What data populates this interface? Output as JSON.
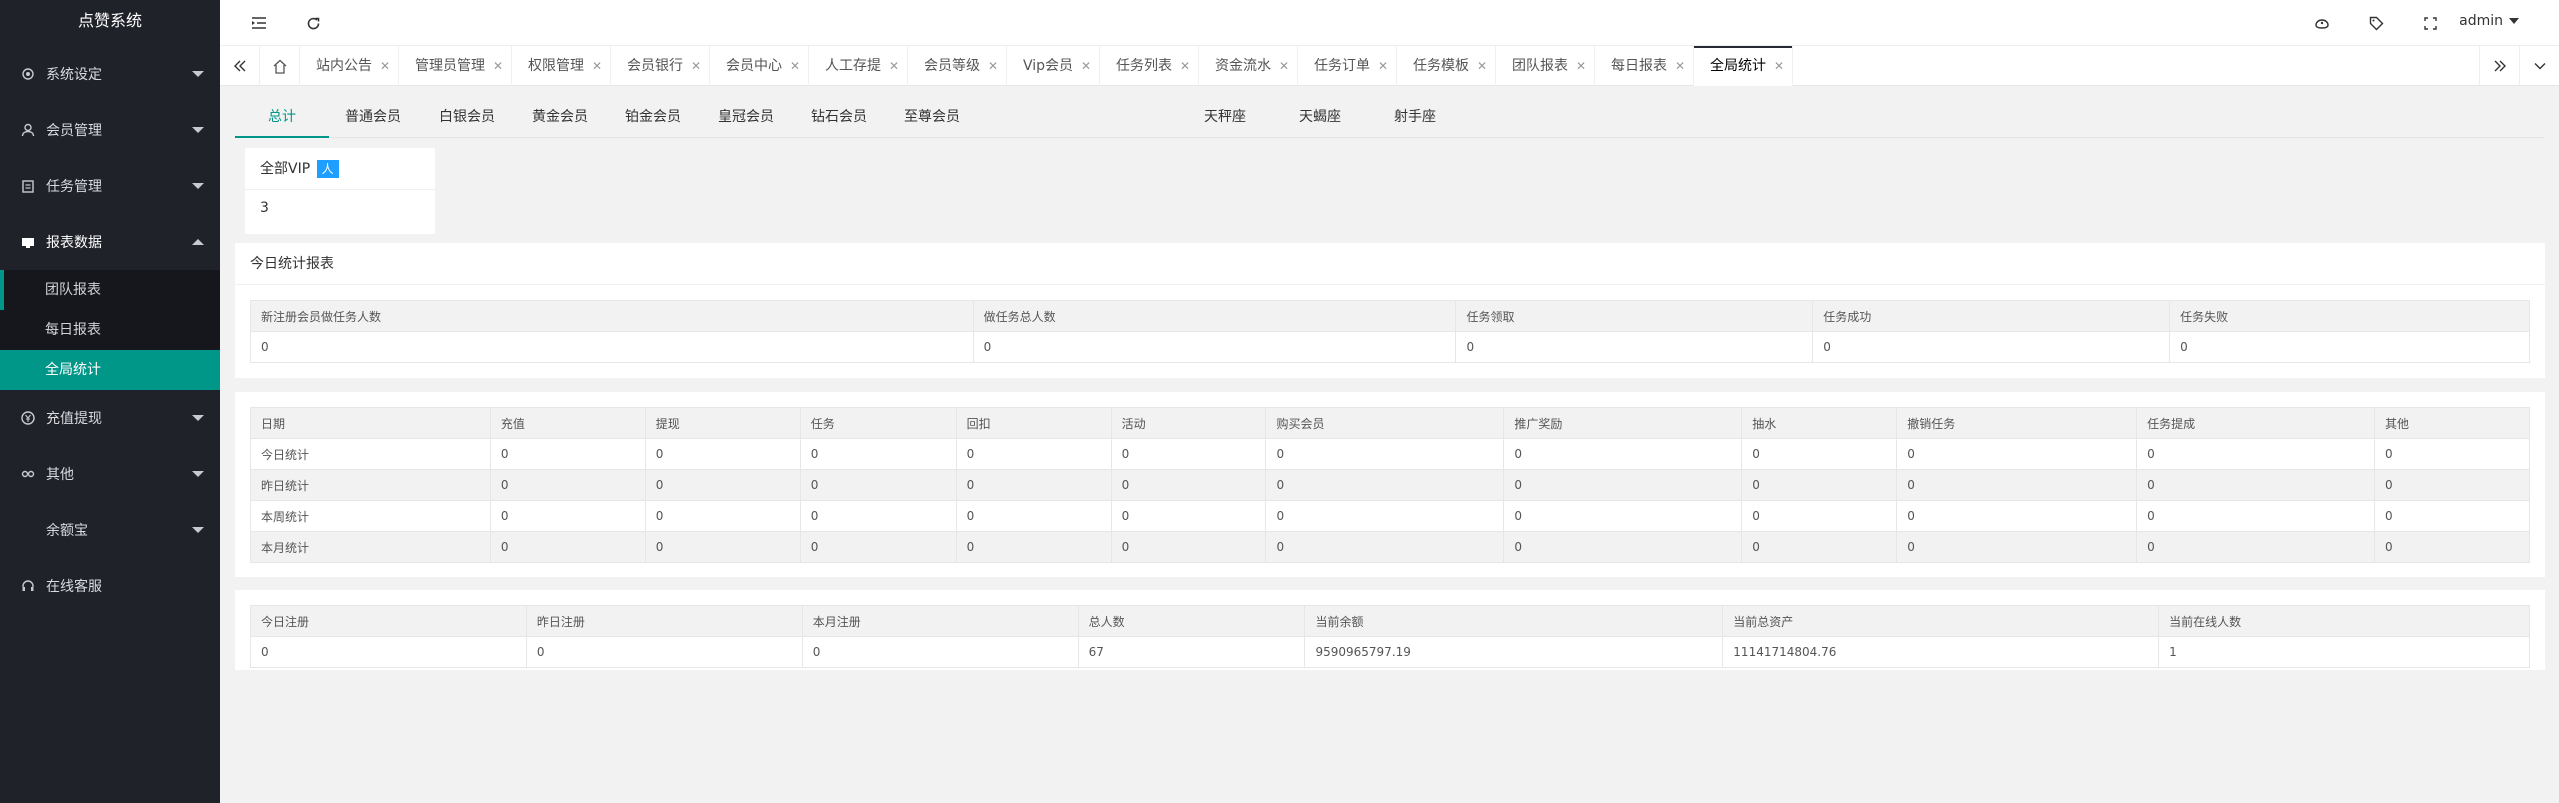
{
  "app": {
    "title": "点赞系统"
  },
  "sidebar": {
    "items": [
      {
        "label": "系统设定",
        "icon": "gear-icon"
      },
      {
        "label": "会员管理",
        "icon": "user-icon"
      },
      {
        "label": "任务管理",
        "icon": "list-icon"
      },
      {
        "label": "报表数据",
        "icon": "chart-icon"
      },
      {
        "label": "充值提现",
        "icon": "yen-icon"
      },
      {
        "label": "其他",
        "icon": "link-icon"
      },
      {
        "label": "余额宝",
        "icon": ""
      },
      {
        "label": "在线客服",
        "icon": "headset-icon"
      }
    ],
    "report_sub": [
      "团队报表",
      "每日报表",
      "全局统计"
    ]
  },
  "header": {
    "user": "admin"
  },
  "tabs": [
    "站内公告",
    "管理员管理",
    "权限管理",
    "会员银行",
    "会员中心",
    "人工存提",
    "会员等级",
    "Vip会员",
    "任务列表",
    "资金流水",
    "任务订单",
    "任务模板",
    "团队报表",
    "每日报表",
    "全局统计"
  ],
  "sub_tabs": [
    "总计",
    "普通会员",
    "白银会员",
    "黄金会员",
    "铂金会员",
    "皇冠会员",
    "钻石会员",
    "至尊会员",
    "天秤座",
    "天蝎座",
    "射手座"
  ],
  "vip_card": {
    "label": "全部VIP",
    "badge": "人",
    "value": "3"
  },
  "today_report": {
    "title": "今日统计报表",
    "headers": [
      "新注册会员做任务人数",
      "做任务总人数",
      "任务领取",
      "任务成功",
      "任务失败"
    ],
    "values": [
      "0",
      "0",
      "0",
      "0",
      "0"
    ]
  },
  "stats_table": {
    "headers": [
      "日期",
      "充值",
      "提现",
      "任务",
      "回扣",
      "活动",
      "购买会员",
      "推广奖励",
      "抽水",
      "撤销任务",
      "任务提成",
      "其他"
    ],
    "rows": [
      [
        "今日统计",
        "0",
        "0",
        "0",
        "0",
        "0",
        "0",
        "0",
        "0",
        "0",
        "0",
        "0"
      ],
      [
        "昨日统计",
        "0",
        "0",
        "0",
        "0",
        "0",
        "0",
        "0",
        "0",
        "0",
        "0",
        "0"
      ],
      [
        "本周统计",
        "0",
        "0",
        "0",
        "0",
        "0",
        "0",
        "0",
        "0",
        "0",
        "0",
        "0"
      ],
      [
        "本月统计",
        "0",
        "0",
        "0",
        "0",
        "0",
        "0",
        "0",
        "0",
        "0",
        "0",
        "0"
      ]
    ]
  },
  "summary_table": {
    "headers": [
      "今日注册",
      "昨日注册",
      "本月注册",
      "总人数",
      "当前余额",
      "当前总资产",
      "当前在线人数"
    ],
    "values": [
      "0",
      "0",
      "0",
      "67",
      "9590965797.19",
      "11141714804.76",
      "1"
    ]
  },
  "colors": {
    "accent": "#009688",
    "sidebar_bg": "#20222a",
    "badge": "#1e9fff"
  }
}
